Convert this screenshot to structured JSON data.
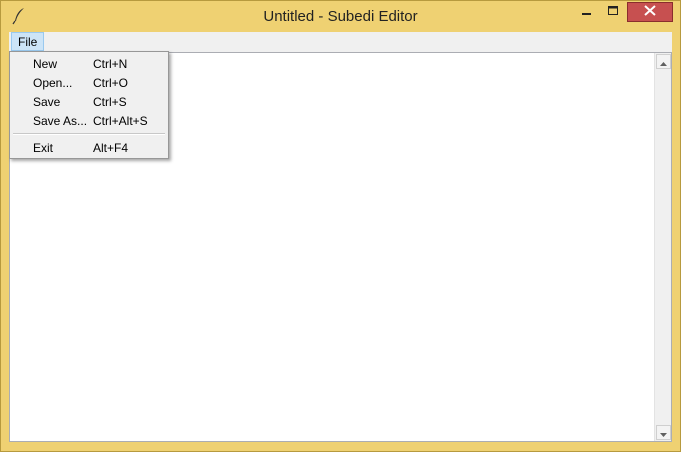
{
  "window": {
    "title": "Untitled - Subedi Editor",
    "icon": "feather-quill-icon",
    "controls": [
      "minimize-icon",
      "maximize-icon",
      "close-icon"
    ],
    "close_color": "#c75050",
    "frame_color": "#efd172"
  },
  "menubar": {
    "items": [
      {
        "label": "File",
        "active": true
      }
    ]
  },
  "file_menu": {
    "items": [
      {
        "label": "New",
        "accelerator": "Ctrl+N"
      },
      {
        "label": "Open...",
        "accelerator": "Ctrl+O"
      },
      {
        "label": "Save",
        "accelerator": "Ctrl+S"
      },
      {
        "label": "Save As...",
        "accelerator": "Ctrl+Alt+S"
      },
      {
        "label": "Exit",
        "accelerator": "Alt+F4"
      }
    ]
  },
  "editor": {
    "content": ""
  },
  "scrollbar": {
    "up_icon": "arrow-up-icon",
    "down_icon": "arrow-down-icon"
  }
}
